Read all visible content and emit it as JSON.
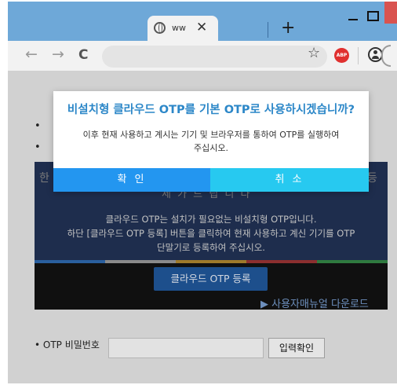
{
  "browser": {
    "tab_title": "ww",
    "tab_close": "✕",
    "new_tab": "+",
    "nav_back": "←",
    "nav_forward": "→",
    "nav_reload": "C",
    "star": "☆",
    "adblock_label": "ABP"
  },
  "page": {
    "bullets": [
      "•",
      "•"
    ],
    "banner_heading": "세 가 드 립 니 다",
    "banner_line1": "클라우드 OTP는 설치가 필요없는 비설치형 OTP입니다.",
    "banner_line2": "하단 [클라우드 OTP 등록] 버튼을 클릭하여 현재 사용하고 계신 기기를 OTP",
    "banner_line3": "단말기로 등록하여 주십시오.",
    "register_button": "클라우드 OTP 등록",
    "manual_link": "▶ 사용자매뉴얼 다운로드",
    "otp_label": "• OTP 비밀번호",
    "confirm_input_button": "입력확인",
    "stripe_colors": [
      "#2a5f9e",
      "#8a8a8a",
      "#9e7a2a",
      "#8c2f2f",
      "#2f7a3f"
    ]
  },
  "dialog": {
    "title": "비설치형 클라우드 OTP를 기본 OTP로 사용하시겠습니까?",
    "message_line1": "이후 현재 사용하고 계시는 기기 및 브라우저를 통하여 OTP를 실행하여",
    "message_line2": "주십시오.",
    "ok_button": "확 인",
    "cancel_button": "취 소",
    "accent_color": "#2396f0",
    "cancel_color": "#27c9f0"
  }
}
